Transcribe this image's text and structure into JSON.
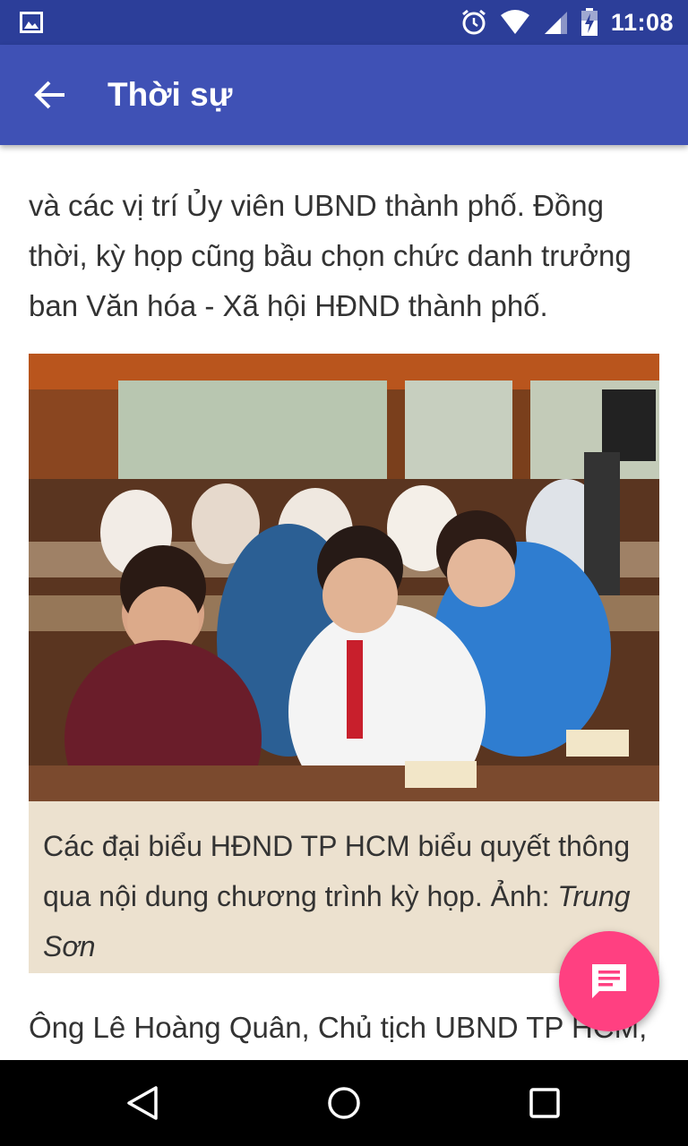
{
  "status_bar": {
    "time": "11:08",
    "icons": [
      "gallery-icon",
      "alarm-icon",
      "wifi-icon",
      "signal-icon",
      "battery-icon"
    ]
  },
  "app_bar": {
    "title": "Thời sự",
    "back_icon": "arrow-back-icon",
    "color": "#3f51b5"
  },
  "article": {
    "paragraph_top": "và các vị trí Ủy viên UBND thành phố. Đồng thời, kỳ họp cũng bầu chọn chức danh trưởng ban Văn hóa - Xã hội HĐND thành phố.",
    "caption_main": "Các đại biểu HĐND TP HCM biểu quyết thông qua nội dung chương trình kỳ họp. Ảnh: ",
    "caption_credit": "Trung Sơn",
    "caption_bg": "#ece1cf",
    "paragraph_bottom": "Ông Lê Hoàng Quân, Chủ tịch UBND TP HCM,"
  },
  "fab": {
    "icon": "comment-icon",
    "color": "#ff4081"
  },
  "nav_bar": {
    "buttons": [
      "back-triangle-icon",
      "home-circle-icon",
      "recents-square-icon"
    ]
  }
}
